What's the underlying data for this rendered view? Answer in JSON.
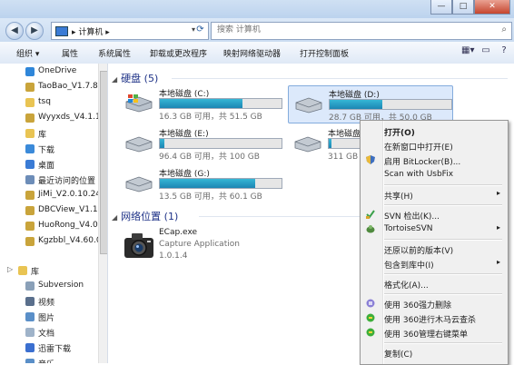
{
  "window": {
    "minimize": "—",
    "maximize": "□",
    "close": "✕"
  },
  "address": {
    "crumb": "▸ 计算机 ▸",
    "placeholder": "搜索 计算机"
  },
  "toolbar": {
    "organize": "组织 ▾",
    "properties": "属性",
    "system_properties": "系统属性",
    "uninstall": "卸载或更改程序",
    "map_drive": "映射网络驱动器",
    "control_panel": "打开控制面板"
  },
  "sidebar": {
    "items": [
      {
        "label": "OneDrive",
        "icon": "onedrive-icon",
        "color": "#2f86d9"
      },
      {
        "label": "TaoBao_V1.7.8.",
        "icon": "file-icon",
        "color": "#c9a43b"
      },
      {
        "label": "tsq",
        "icon": "folder-icon",
        "color": "#e9c453"
      },
      {
        "label": "Wyyxds_V4.1.1.",
        "icon": "file-icon",
        "color": "#c9a43b"
      },
      {
        "label": "库",
        "icon": "library-icon",
        "color": "#e9c453"
      },
      {
        "label": "下载",
        "icon": "download-icon",
        "color": "#3b8ad9"
      },
      {
        "label": "桌面",
        "icon": "desktop-icon",
        "color": "#3a7bd5"
      },
      {
        "label": "最近访问的位置",
        "icon": "recent-icon",
        "color": "#6d8db8"
      },
      {
        "label": "JiMi_V2.0.10.24",
        "icon": "file-icon",
        "color": "#c9a43b"
      },
      {
        "label": "DBCView_V1.1.",
        "icon": "file-icon",
        "color": "#c9a43b"
      },
      {
        "label": "HuoRong_V4.0.",
        "icon": "file-icon",
        "color": "#c9a43b"
      },
      {
        "label": "Kgzbbl_V4.60.0",
        "icon": "file-icon",
        "color": "#c9a43b"
      },
      {
        "label": "库",
        "icon": "library-icon",
        "color": "#e9c453"
      },
      {
        "label": "Subversion",
        "icon": "svn-icon",
        "color": "#8aa0b8"
      },
      {
        "label": "视频",
        "icon": "video-icon",
        "color": "#5a6f8c"
      },
      {
        "label": "图片",
        "icon": "picture-icon",
        "color": "#5a8fc8"
      },
      {
        "label": "文档",
        "icon": "document-icon",
        "color": "#9fb3c9"
      },
      {
        "label": "迅雷下载",
        "icon": "thunder-icon",
        "color": "#3b6fd0"
      },
      {
        "label": "音乐",
        "icon": "music-icon",
        "color": "#5a8fc8"
      }
    ]
  },
  "main": {
    "hdd_group": "硬盘 (5)",
    "net_group": "网络位置 (1)",
    "drives": [
      {
        "name": "本地磁盘 (C:)",
        "size": "16.3 GB 可用，共 51.5 GB",
        "used": 0.68
      },
      {
        "name": "本地磁盘 (D:)",
        "size": "28.7 GB 可用，共 50.0 GB",
        "used": 0.43
      },
      {
        "name": "本地磁盘 (E:)",
        "size": "96.4 GB 可用，共 100 GB",
        "used": 0.04
      },
      {
        "name": "本地磁盘 (F:)",
        "size": "311 GB 可用，共 31",
        "used": 0.02
      },
      {
        "name": "本地磁盘 (G:)",
        "size": "13.5 GB 可用，共 60.1 GB",
        "used": 0.78
      }
    ],
    "app": {
      "name": "ECap.exe",
      "desc": "Capture Application",
      "version": "1.0.1.4"
    }
  },
  "context_menu": {
    "open": "打开(O)",
    "open_new_window": "在新窗口中打开(E)",
    "bitlocker": "启用 BitLocker(B)...",
    "usbfix": "Scan with UsbFix",
    "share": "共享(H)",
    "svn_checkout": "SVN 检出(K)...",
    "tortoisesvn": "TortoiseSVN",
    "restore": "还原以前的版本(V)",
    "include_library": "包含到库中(I)",
    "format": "格式化(A)...",
    "force_delete": "使用 360强力删除",
    "trojan_scan": "使用 360进行木马云查杀",
    "manage_menu": "使用 360管理右键菜单",
    "copy": "复制(C)",
    "submenu_arrow": "▸"
  }
}
